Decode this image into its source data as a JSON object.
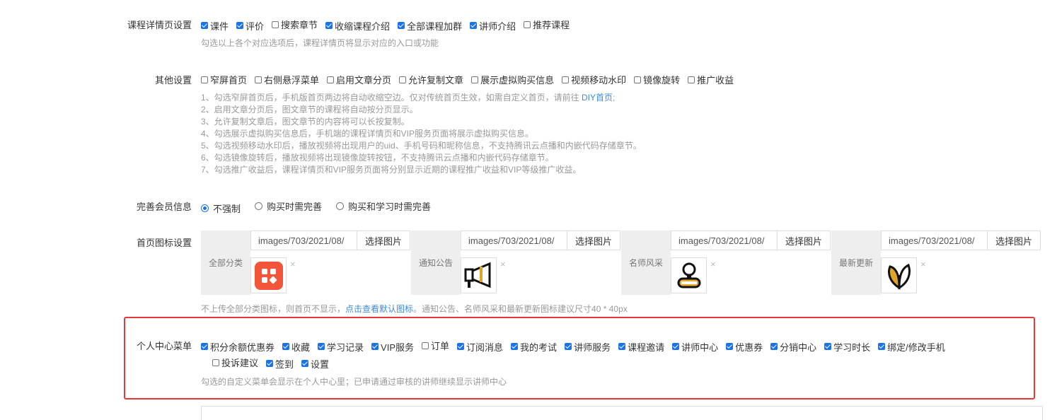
{
  "course_detail": {
    "label": "课程详情页设置",
    "options": [
      {
        "label": "课件",
        "checked": true
      },
      {
        "label": "评价",
        "checked": true
      },
      {
        "label": "搜索章节",
        "checked": false
      },
      {
        "label": "收缩课程介绍",
        "checked": true
      },
      {
        "label": "全部课程加群",
        "checked": true
      },
      {
        "label": "讲师介绍",
        "checked": true
      },
      {
        "label": "推荐课程",
        "checked": false
      }
    ],
    "help": "勾选以上各个对应选项后，课程详情页将显示对应的入口或功能"
  },
  "other": {
    "label": "其他设置",
    "options": [
      {
        "label": "窄屏首页",
        "checked": false
      },
      {
        "label": "右侧悬浮菜单",
        "checked": false
      },
      {
        "label": "启用文章分页",
        "checked": false
      },
      {
        "label": "允许复制文章",
        "checked": false
      },
      {
        "label": "展示虚拟购买信息",
        "checked": false
      },
      {
        "label": "视频移动水印",
        "checked": false
      },
      {
        "label": "镜像旋转",
        "checked": false
      },
      {
        "label": "推广收益",
        "checked": false
      }
    ],
    "help1_pre": "1、勾选窄屏首页后，手机版首页两边将自动收缩空边。仅对传统首页生效，如需自定义首页，请前往 ",
    "help1_link": "DIY首页",
    "help1_post": ";",
    "help_lines": [
      "2、启用文章分页后，图文章节的课程将自动按分页显示。",
      "3、允许复制文章后，图文章节的内容将可以长按复制。",
      "4、勾选展示虚拟购买信息后，手机端的课程详情页和VIP服务页面将展示虚拟购买信息。",
      "5、勾选视频移动水印后，播放视频将出现用户的uid、手机号码和昵称信息，不支持腾讯云点播和内嵌代码存储章节。",
      "6、勾选镜像旋转后，播放视频将出现镜像旋转按钮，不支持腾讯云点播和内嵌代码存储章节。",
      "7、勾选推广收益后，课程详情页和VIP服务页面将分别显示近期的课程推广收益和VIP等级推广收益。"
    ]
  },
  "member": {
    "label": "完善会员信息",
    "options": [
      {
        "label": "不强制",
        "checked": true
      },
      {
        "label": "购买时需完善",
        "checked": false
      },
      {
        "label": "购买和学习时需完善",
        "checked": false
      }
    ]
  },
  "home_icons": {
    "label": "首页图标设置",
    "cards": [
      {
        "name": "全部分类",
        "path": "images/703/2021/08/",
        "button": "选择图片",
        "icon": "grid-icon"
      },
      {
        "name": "通知公告",
        "path": "images/703/2021/08/",
        "button": "选择图片",
        "icon": "megaphone-icon"
      },
      {
        "name": "名师风采",
        "path": "images/703/2021/08/",
        "button": "选择图片",
        "icon": "teacher-icon"
      },
      {
        "name": "最新更新",
        "path": "images/703/2021/08/",
        "button": "选择图片",
        "icon": "leaf-icon"
      }
    ],
    "delete_glyph": "×",
    "help_pre": "不上传全部分类图标，则首页不显示，",
    "help_link": "点击查看默认图标",
    "help_post": "。通知公告、名师风采和最新更新图标建议尺寸40 * 40px"
  },
  "personal_menu": {
    "label": "个人中心菜单",
    "row1": [
      {
        "label": "积分余额优惠券",
        "checked": true
      },
      {
        "label": "收藏",
        "checked": true
      },
      {
        "label": "学习记录",
        "checked": true
      },
      {
        "label": "VIP服务",
        "checked": true
      },
      {
        "label": "订单",
        "checked": false
      },
      {
        "label": "订阅消息",
        "checked": true
      },
      {
        "label": "我的考试",
        "checked": true
      },
      {
        "label": "讲师服务",
        "checked": true
      },
      {
        "label": "课程邀请",
        "checked": true
      },
      {
        "label": "讲师中心",
        "checked": true
      },
      {
        "label": "优惠券",
        "checked": true
      },
      {
        "label": "分销中心",
        "checked": true
      },
      {
        "label": "学习时长",
        "checked": true
      },
      {
        "label": "绑定/修改手机",
        "checked": true
      }
    ],
    "row2": [
      {
        "label": "投诉建议",
        "checked": false
      },
      {
        "label": "签到",
        "checked": true
      },
      {
        "label": "设置",
        "checked": true
      }
    ],
    "help": "勾选的自定义菜单会显示在个人中心里；已申请通过审核的讲师继续显示讲师中心"
  },
  "colors": {
    "accent": "#1a73e8",
    "highlight": "#e53935",
    "link": "#3e8bd6"
  }
}
